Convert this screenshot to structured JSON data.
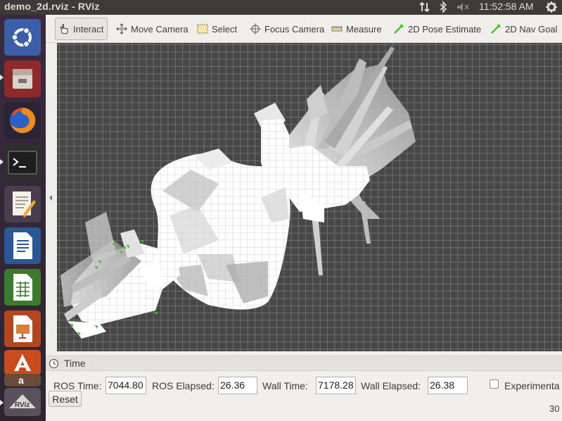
{
  "window": {
    "title": "demo_2d.rviz - RViz"
  },
  "tray": {
    "clock": "11:52:58 AM"
  },
  "launcher": {
    "items": [
      {
        "name": "ubuntu-dash-icon",
        "color": "#3b5ea8"
      },
      {
        "name": "files-icon",
        "color": "#8e2a2a"
      },
      {
        "name": "firefox-icon",
        "color": "#2b2436"
      },
      {
        "name": "terminal-icon",
        "color": "#2e2e2e"
      },
      {
        "name": "text-editor-icon",
        "color": "#4a3d4e"
      },
      {
        "name": "writer-icon",
        "color": "#2a5795"
      },
      {
        "name": "calc-icon",
        "color": "#3c7b2d"
      },
      {
        "name": "impress-icon",
        "color": "#b3461d"
      },
      {
        "name": "software-center-icon",
        "color": "#c94b1e"
      },
      {
        "name": "amazon-icon",
        "color": "#6a4b3a"
      },
      {
        "name": "rviz-icon",
        "color": "#58505a"
      }
    ]
  },
  "toolbar": {
    "interact": "Interact",
    "move_camera": "Move Camera",
    "select": "Select",
    "focus_camera": "Focus Camera",
    "measure": "Measure",
    "pose_estimate": "2D Pose Estimate",
    "nav_goal": "2D Nav Goal"
  },
  "time_panel": {
    "title": "Time",
    "ros_time_label": "ROS Time:",
    "ros_time_value": "7044.80",
    "ros_elapsed_label": "ROS Elapsed:",
    "ros_elapsed_value": "26.36",
    "wall_time_label": "Wall Time:",
    "wall_time_value": "7178.28",
    "wall_elapsed_label": "Wall Elapsed:",
    "wall_elapsed_value": "26.38",
    "experimental_label": "Experimenta",
    "reset_label": "Reset",
    "fps": "30"
  },
  "colors": {
    "accent": "#3fc41f",
    "grid": "#6e6e6e",
    "background": "#474747"
  }
}
